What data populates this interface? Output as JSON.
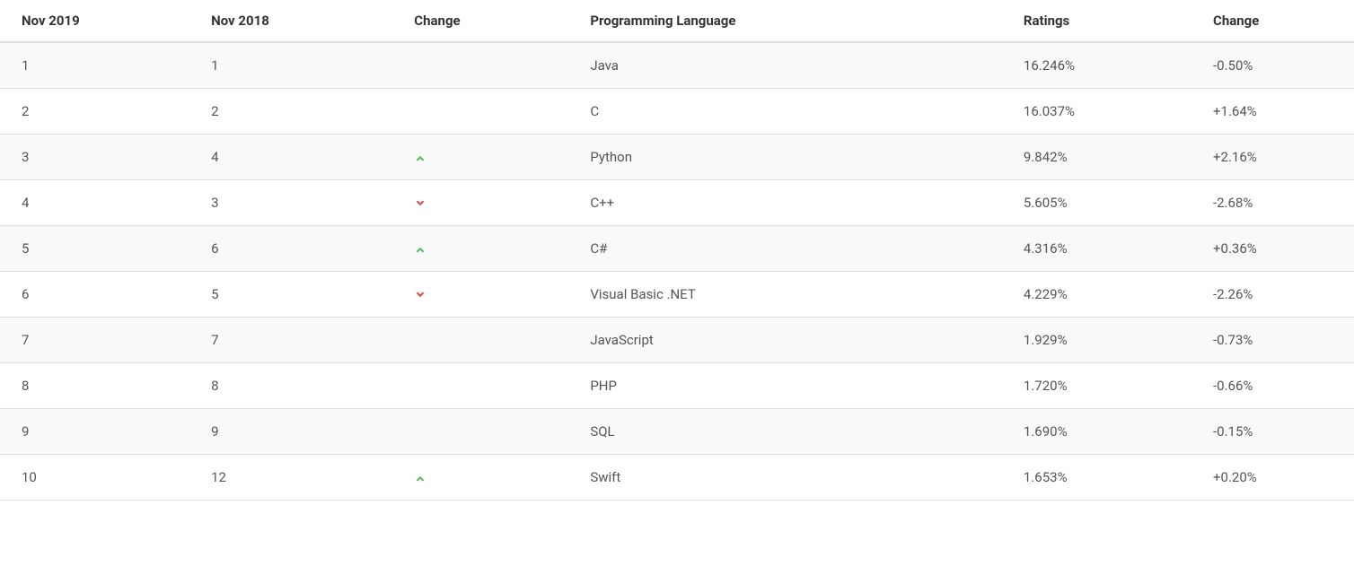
{
  "chart_data": {
    "type": "table",
    "columns": [
      "Nov 2019",
      "Nov 2018",
      "Change",
      "Programming Language",
      "Ratings",
      "Change"
    ],
    "rows": [
      {
        "rank2019": "1",
        "rank2018": "1",
        "direction": "",
        "language": "Java",
        "ratings": "16.246%",
        "delta": "-0.50%"
      },
      {
        "rank2019": "2",
        "rank2018": "2",
        "direction": "",
        "language": "C",
        "ratings": "16.037%",
        "delta": "+1.64%"
      },
      {
        "rank2019": "3",
        "rank2018": "4",
        "direction": "up",
        "language": "Python",
        "ratings": "9.842%",
        "delta": "+2.16%"
      },
      {
        "rank2019": "4",
        "rank2018": "3",
        "direction": "down",
        "language": "C++",
        "ratings": "5.605%",
        "delta": "-2.68%"
      },
      {
        "rank2019": "5",
        "rank2018": "6",
        "direction": "up",
        "language": "C#",
        "ratings": "4.316%",
        "delta": "+0.36%"
      },
      {
        "rank2019": "6",
        "rank2018": "5",
        "direction": "down",
        "language": "Visual Basic .NET",
        "ratings": "4.229%",
        "delta": "-2.26%"
      },
      {
        "rank2019": "7",
        "rank2018": "7",
        "direction": "",
        "language": "JavaScript",
        "ratings": "1.929%",
        "delta": "-0.73%"
      },
      {
        "rank2019": "8",
        "rank2018": "8",
        "direction": "",
        "language": "PHP",
        "ratings": "1.720%",
        "delta": "-0.66%"
      },
      {
        "rank2019": "9",
        "rank2018": "9",
        "direction": "",
        "language": "SQL",
        "ratings": "1.690%",
        "delta": "-0.15%"
      },
      {
        "rank2019": "10",
        "rank2018": "12",
        "direction": "up",
        "language": "Swift",
        "ratings": "1.653%",
        "delta": "+0.20%"
      }
    ]
  }
}
